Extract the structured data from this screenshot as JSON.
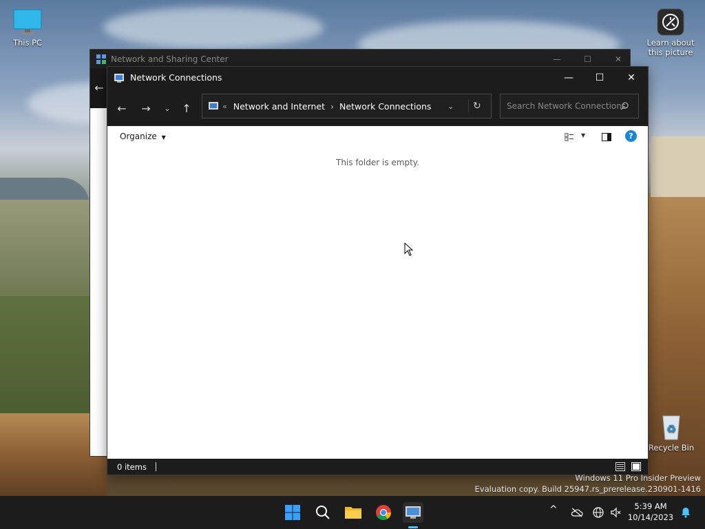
{
  "desktop": {
    "this_pc_label": "This PC",
    "learn_label_1": "Learn about",
    "learn_label_2": "this picture",
    "recycle_label": "Recycle Bin"
  },
  "back_window": {
    "title": "Network and Sharing Center"
  },
  "window": {
    "title": "Network Connections",
    "breadcrumb_prefix": "«",
    "breadcrumb": [
      "Network and Internet",
      "Network Connections"
    ],
    "search_placeholder": "Search Network Connections",
    "organize_label": "Organize",
    "empty_message": "This folder is empty.",
    "status_items": "0 items"
  },
  "watermark": {
    "line1": "Windows 11 Pro Insider Preview",
    "line2": "Evaluation copy. Build 25947.rs_prerelease.230901-1416"
  },
  "clock": {
    "time": "5:39 AM",
    "date": "10/14/2023"
  },
  "colors": {
    "accent": "#0078d4",
    "titlebar": "#1c1c1c",
    "help": "#1a86d6"
  }
}
